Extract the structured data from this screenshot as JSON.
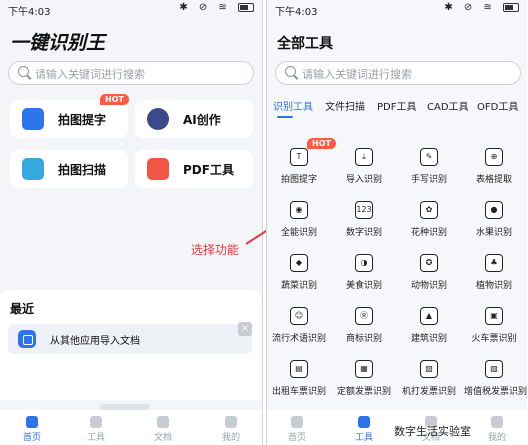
{
  "left": {
    "status_time": "下午4:03",
    "status_icons": "✱ ⊘ ≋",
    "app_title": "一键识别王",
    "search_placeholder": "请输入关键词进行搜索",
    "cards": [
      {
        "label": "拍图提字",
        "hot": "HOT",
        "color": "#2d73ea"
      },
      {
        "label": "AI创作",
        "color": "#3a4b8c"
      },
      {
        "label": "拍图扫描",
        "color": "#35a8e0"
      },
      {
        "label": "PDF工具",
        "color": "#f05545"
      }
    ],
    "recent_title": "最近",
    "import_label": "从其他应用导入文档",
    "nav": [
      "首页",
      "工具",
      "文档",
      "我的"
    ]
  },
  "right": {
    "status_time": "下午4:03",
    "status_icons": "✱ ⊘ ≋",
    "title": "全部工具",
    "search_placeholder": "请输入关键词进行搜索",
    "tabs": [
      "识别工具",
      "文件扫描",
      "PDF工具",
      "CAD工具",
      "OFD工具"
    ],
    "tools": [
      {
        "label": "拍图提字",
        "icon": "T",
        "hot": "HOT"
      },
      {
        "label": "导入识别",
        "icon": "⤓"
      },
      {
        "label": "手写识别",
        "icon": "✎"
      },
      {
        "label": "表格提取",
        "icon": "⊕"
      },
      {
        "label": "全能识别",
        "icon": "◉"
      },
      {
        "label": "数字识别",
        "icon": "123"
      },
      {
        "label": "花种识别",
        "icon": "✿"
      },
      {
        "label": "水果识别",
        "icon": "●"
      },
      {
        "label": "蔬菜识别",
        "icon": "◆"
      },
      {
        "label": "美食识别",
        "icon": "◑"
      },
      {
        "label": "动物识别",
        "icon": "✪"
      },
      {
        "label": "植物识别",
        "icon": "♣"
      },
      {
        "label": "流行术语识别",
        "icon": "☺"
      },
      {
        "label": "商标识别",
        "icon": "Ⓡ"
      },
      {
        "label": "建筑识别",
        "icon": "▲"
      },
      {
        "label": "火车票识别",
        "icon": "▣"
      },
      {
        "label": "出租车票识别",
        "icon": "▤"
      },
      {
        "label": "定额发票识别",
        "icon": "▦"
      },
      {
        "label": "机打发票识别",
        "icon": "▧"
      },
      {
        "label": "增值税发票识别",
        "icon": "▨"
      }
    ],
    "nav": [
      "首页",
      "工具",
      "文档",
      "我的"
    ]
  },
  "annotation": "选择功能",
  "watermark": "数字生活实验室",
  "colors": {
    "accent": "#2d73ea",
    "annotation": "#e4393c",
    "hot": "#ff5a43"
  }
}
